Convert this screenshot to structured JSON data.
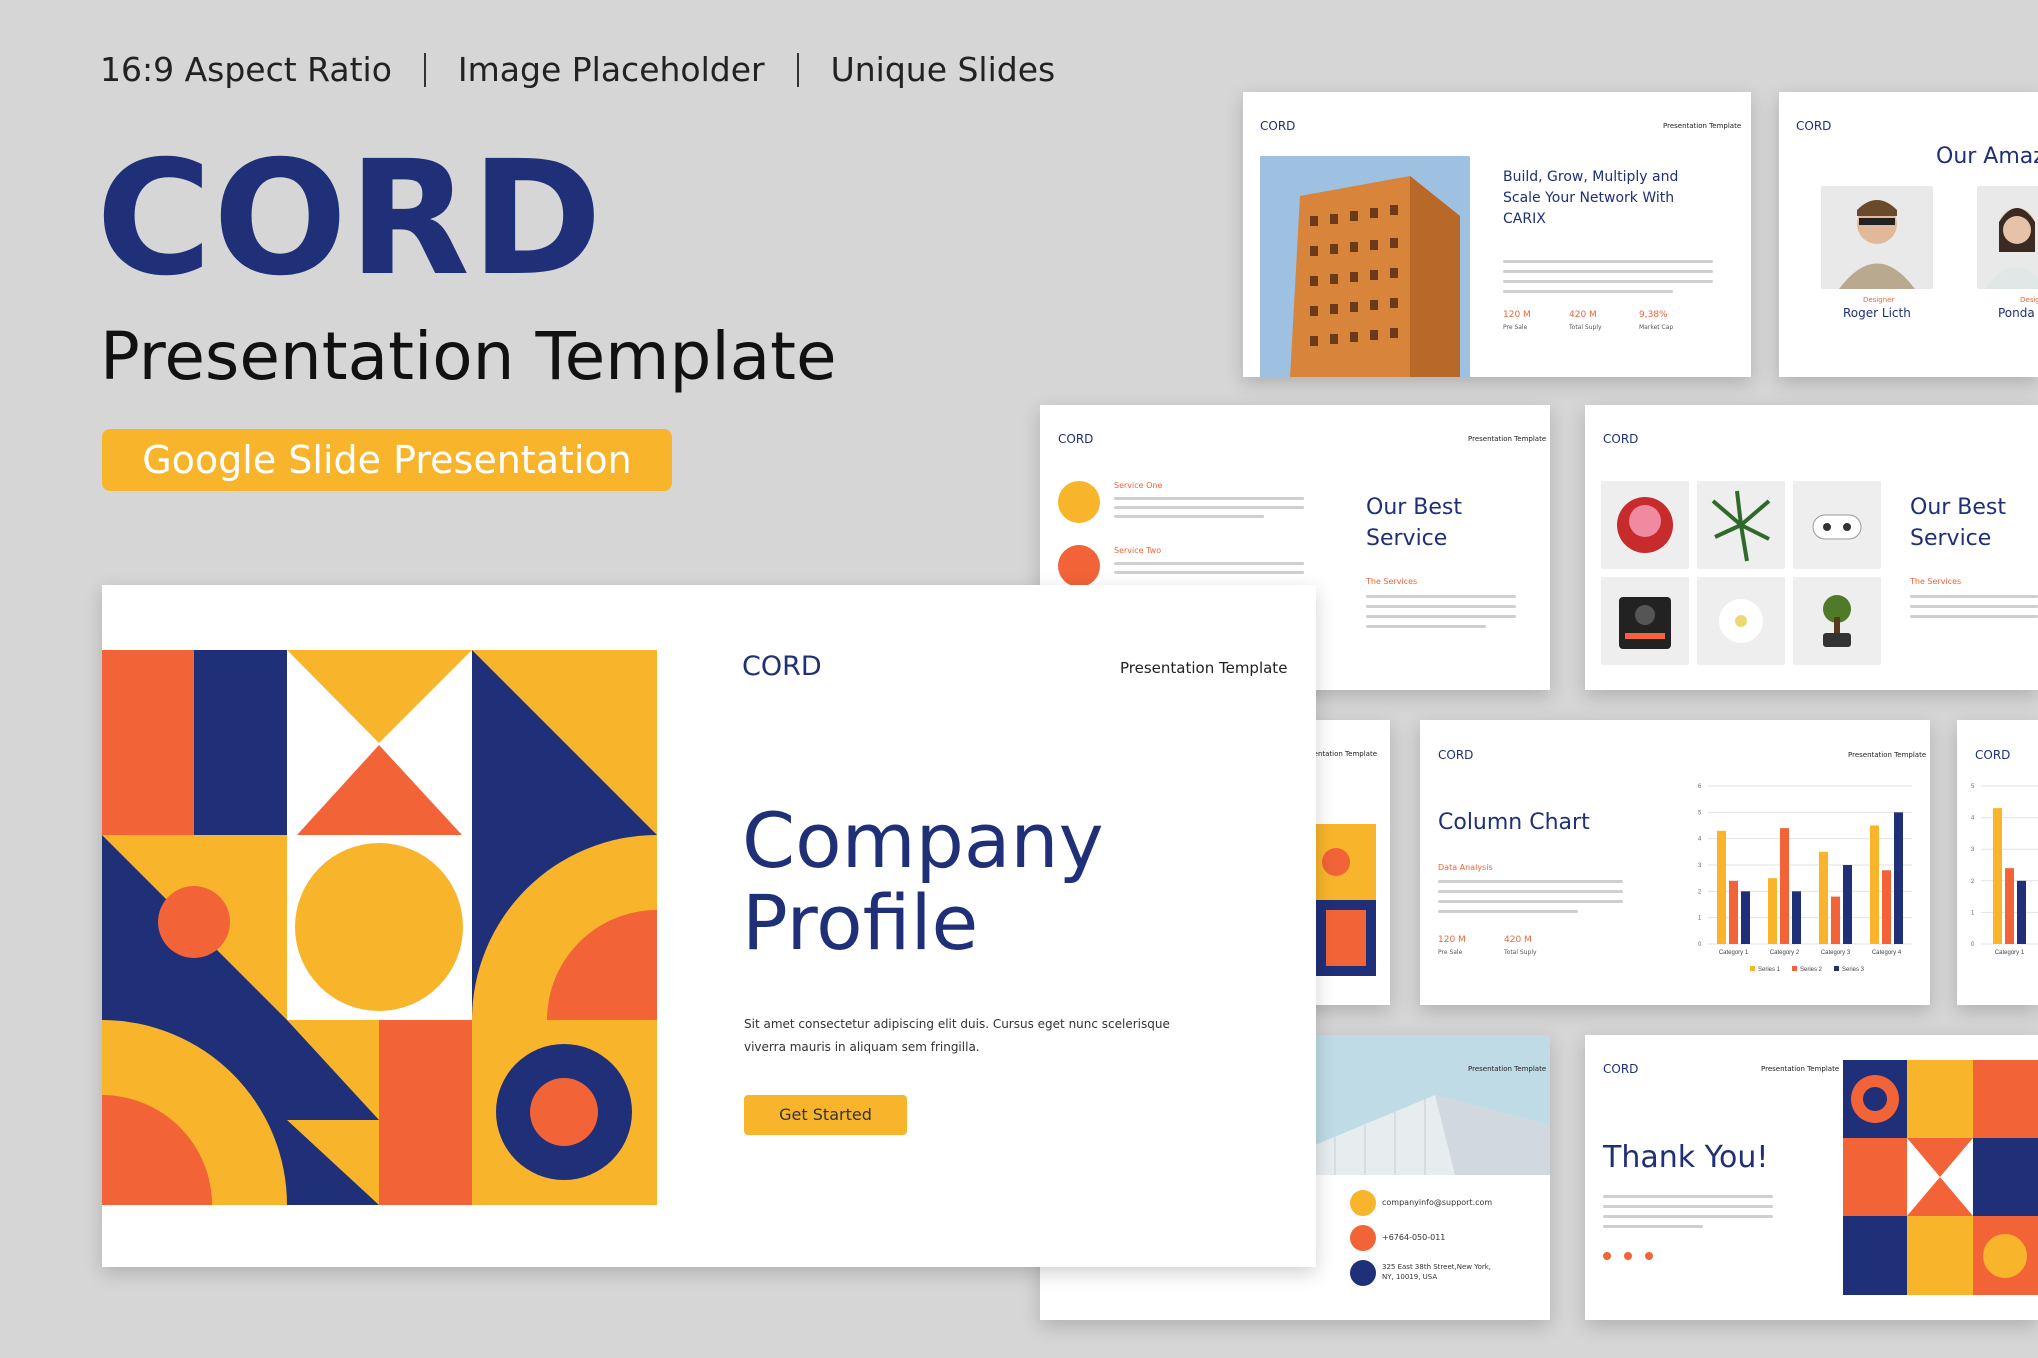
{
  "header": {
    "features": [
      "16:9 Aspect Ratio",
      "Image Placeholder",
      "Unique Slides"
    ],
    "brand": "CORD",
    "subtitle": "Presentation Template",
    "badge": "Google Slide Presentation"
  },
  "colors": {
    "navy": "#1f2f78",
    "orange": "#f26338",
    "yellow": "#f8b52c",
    "background": "#d6d6d6"
  },
  "main_slide": {
    "logo": "CORD",
    "tag": "Presentation Template",
    "headline": "Company Profile",
    "body": "Sit amet consectetur  adipiscing elit duis. Cursus  eget nunc scelerisque viverra  mauris  in aliquam sem fringilla.",
    "cta": "Get Started"
  },
  "slides": {
    "network": {
      "logo": "CORD",
      "tag": "Presentation Template",
      "title": "Build, Grow, Multiply and Scale Your Network With CARIX",
      "stats": [
        {
          "value": "120 M",
          "label": "Pre Sale"
        },
        {
          "value": "420 M",
          "label": "Total Suply"
        },
        {
          "value": "9,38%",
          "label": "Market Cap"
        }
      ]
    },
    "team": {
      "logo": "CORD",
      "title": "Our Amaz",
      "members": [
        {
          "role": "Designer",
          "name": "Roger Licth"
        },
        {
          "role": "Desig",
          "name": "Ponda"
        }
      ]
    },
    "services_a": {
      "logo": "CORD",
      "tag": "Presentation Template",
      "items": [
        "Service One",
        "Service Two"
      ],
      "title": "Our Best Service",
      "subtitle": "The Services"
    },
    "services_b": {
      "logo": "CORD",
      "title": "Our Best Service",
      "subtitle": "The Services"
    },
    "partial_left": {
      "tag": "sentation Template"
    },
    "chart_slide": {
      "logo": "CORD",
      "tag": "Presentation Template",
      "title": "Column Chart",
      "subtitle": "Data Analysis",
      "stats": [
        {
          "value": "120 M",
          "label": "Pre Sale"
        },
        {
          "value": "420 M",
          "label": "Total Suply"
        }
      ]
    },
    "chart_partial": {
      "logo": "CORD"
    },
    "contact": {
      "tag": "Presentation Template",
      "email": "companyinfo@support.com",
      "phone": "+6764-050-011",
      "address": "325 East 38th Street,New York, NY, 10019, USA"
    },
    "thanks": {
      "logo": "CORD",
      "tag": "Presentation Template",
      "title": "Thank You!"
    }
  },
  "chart_data": {
    "type": "bar",
    "categories": [
      "Category 1",
      "Category 2",
      "Category 3",
      "Category 4"
    ],
    "series": [
      {
        "name": "Series 1",
        "color": "#f8b52c",
        "values": [
          4.3,
          2.5,
          3.5,
          4.5
        ]
      },
      {
        "name": "Series 2",
        "color": "#f26338",
        "values": [
          2.4,
          4.4,
          1.8,
          2.8
        ]
      },
      {
        "name": "Series 3",
        "color": "#1f2f78",
        "values": [
          2.0,
          2.0,
          3.0,
          5.0
        ]
      }
    ],
    "ylim": [
      0,
      6
    ],
    "yticks": [
      "0",
      "1",
      "2",
      "3",
      "4",
      "5",
      "6"
    ],
    "legend": "bottom"
  },
  "chart_partial_data": {
    "type": "bar",
    "categories": [
      "Category 1"
    ],
    "series": [
      {
        "name": "Series 1",
        "color": "#f8b52c",
        "values": [
          4.3
        ]
      },
      {
        "name": "Series 2",
        "color": "#f26338",
        "values": [
          2.4
        ]
      },
      {
        "name": "Series 3",
        "color": "#1f2f78",
        "values": [
          2.0
        ]
      }
    ],
    "ylim": [
      0,
      5
    ],
    "yticks": [
      "0",
      "1",
      "2",
      "3",
      "4",
      "5"
    ]
  }
}
